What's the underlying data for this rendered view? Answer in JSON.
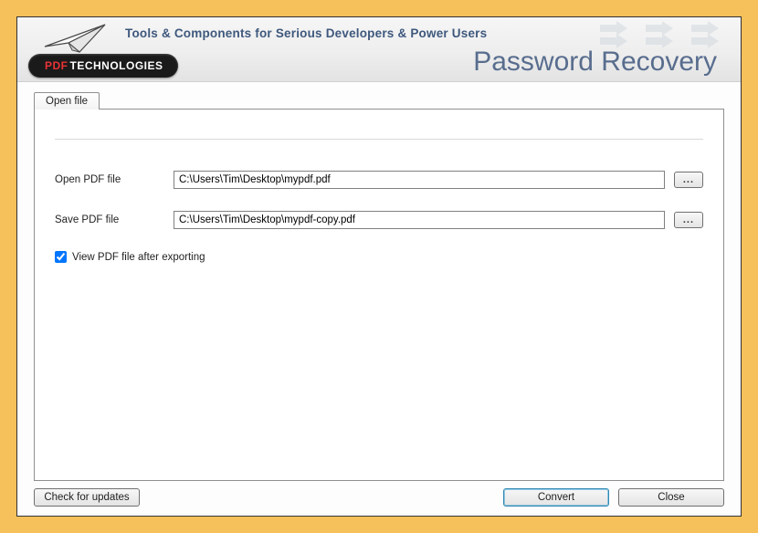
{
  "header": {
    "tagline": "Tools & Components for Serious Developers & Power Users",
    "logo_pdf": "PDF",
    "logo_tech": "TECHNOLOGIES",
    "app_title": "Password Recovery"
  },
  "tabs": {
    "open_file": "Open file"
  },
  "fields": {
    "open_label": "Open PDF file",
    "open_value": "C:\\Users\\Tim\\Desktop\\mypdf.pdf",
    "save_label": "Save PDF file",
    "save_value": "C:\\Users\\Tim\\Desktop\\mypdf-copy.pdf",
    "browse_label": "...",
    "view_after_label": "View PDF file after exporting",
    "view_after_checked": true
  },
  "footer": {
    "check_updates": "Check for updates",
    "convert": "Convert",
    "close": "Close"
  }
}
